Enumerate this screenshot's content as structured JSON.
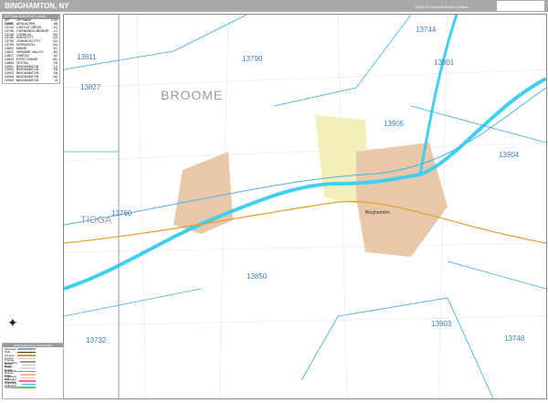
{
  "header": {
    "title": "BINGHAMTON, NY",
    "edition": "2020 ZIP Code Premium Edition",
    "logo": "Market MAPS"
  },
  "zip_table": {
    "title": "ZIP Code Index/Grid Locator",
    "columns": [
      "ZIP Code",
      "ZIP Name",
      "LOC"
    ],
    "rows": [
      [
        "13732",
        "APALACHIN",
        "A6"
      ],
      [
        "13744",
        "CASTLE CREEK",
        "K1"
      ],
      [
        "13745",
        "CHENANGO BRIDGE",
        "L2"
      ],
      [
        "13748",
        "CONKLIN",
        "N4"
      ],
      [
        "13760",
        "ENDICOTT",
        "D4"
      ],
      [
        "13790",
        "JOHNSON CITY",
        "G3"
      ],
      [
        "13795",
        "KIRKWOOD",
        "N4"
      ],
      [
        "13802",
        "MAINE",
        "E1"
      ],
      [
        "13811",
        "NEWARK VALLEY",
        "B1"
      ],
      [
        "13827",
        "OWEGO",
        "A2"
      ],
      [
        "13833",
        "PORT CRANE",
        "M1"
      ],
      [
        "13850",
        "VESTAL",
        "F6"
      ],
      [
        "13901",
        "BINGHAMTON",
        "L4"
      ],
      [
        "13902",
        "BINGHAMTON",
        "K5"
      ],
      [
        "13903",
        "BINGHAMTON",
        "K6"
      ],
      [
        "13904",
        "BINGHAMTON",
        "N3"
      ],
      [
        "13905",
        "BINGHAMTON",
        "I4"
      ]
    ]
  },
  "legend": {
    "title": "2020 Binghamton, NY City Map",
    "items": [
      {
        "label": "Interstate",
        "color": "#7aa9d8"
      },
      {
        "label": "Tolls",
        "color": "#333333"
      },
      {
        "label": "US Hwy",
        "color": "#e0a030"
      },
      {
        "label": "County",
        "color": "#cccccc"
      },
      {
        "label": "Primary Roads",
        "color": "#999999"
      },
      {
        "label": "Secondary Roads",
        "color": "#bbbbbb"
      },
      {
        "label": "Major Roads",
        "color": "#dddddd"
      },
      {
        "label": "Rail Road",
        "color": "#888888"
      },
      {
        "label": "County Highways",
        "color": "#f6b0b0"
      },
      {
        "label": "State Highways",
        "color": "#f7c98a"
      },
      {
        "label": "US Highways",
        "color": "#f066b0"
      },
      {
        "label": "Interstate Highways",
        "color": "#4fb0e8"
      },
      {
        "label": "Toll Roads",
        "color": "#55cc55"
      }
    ]
  },
  "map": {
    "zip_labels": [
      "13811",
      "13790",
      "13744",
      "13801",
      "13827",
      "13905",
      "13904",
      "13760",
      "13850",
      "13732",
      "13903",
      "13748"
    ],
    "county_labels": [
      "BROOME",
      "TIOGA"
    ],
    "city_label": "Binghamton",
    "colors": {
      "river": "#3fd0f0",
      "zip_border": "#30b0e0",
      "city": "#e8c8a8",
      "city2": "#f2f0b8",
      "zip_text": "#3a7fc0"
    }
  }
}
